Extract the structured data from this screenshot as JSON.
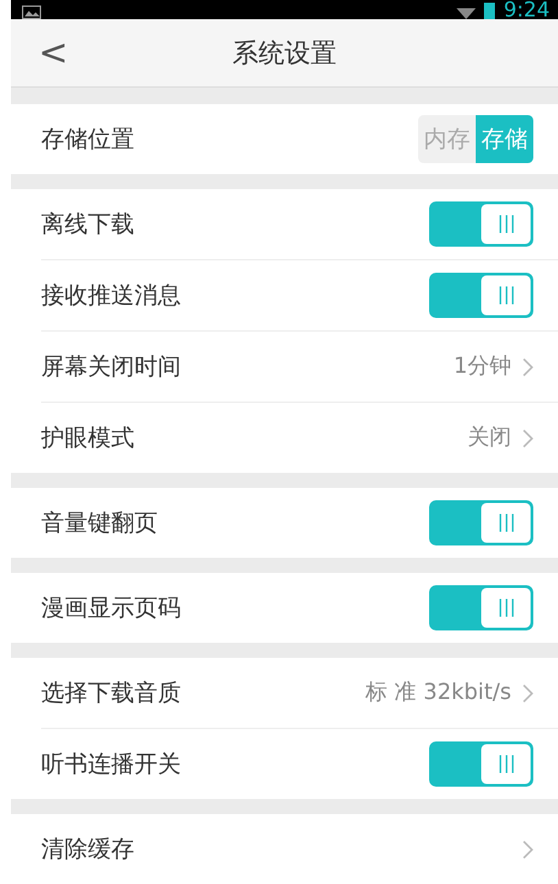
{
  "status_bar": {
    "time": "9:24"
  },
  "header": {
    "back": "<",
    "title": "系统设置"
  },
  "groups": [
    {
      "items": [
        {
          "kind": "segment",
          "label": "存储位置",
          "options": [
            {
              "label": "内存",
              "selected": false
            },
            {
              "label": "存储",
              "selected": true
            }
          ]
        }
      ]
    },
    {
      "items": [
        {
          "kind": "switch",
          "label": "离线下载",
          "on": true
        },
        {
          "kind": "switch",
          "label": "接收推送消息",
          "on": true
        },
        {
          "kind": "value",
          "label": "屏幕关闭时间",
          "value": "1分钟"
        },
        {
          "kind": "value",
          "label": "护眼模式",
          "value": "关闭"
        }
      ]
    },
    {
      "items": [
        {
          "kind": "switch",
          "label": "音量键翻页",
          "on": true
        }
      ]
    },
    {
      "items": [
        {
          "kind": "switch",
          "label": "漫画显示页码",
          "on": true
        }
      ]
    },
    {
      "items": [
        {
          "kind": "value",
          "label": "选择下载音质",
          "value": "标 准 32kbit/s"
        },
        {
          "kind": "switch",
          "label": "听书连播开关",
          "on": true
        }
      ]
    },
    {
      "items": [
        {
          "kind": "action",
          "label": "清除缓存"
        }
      ]
    }
  ]
}
